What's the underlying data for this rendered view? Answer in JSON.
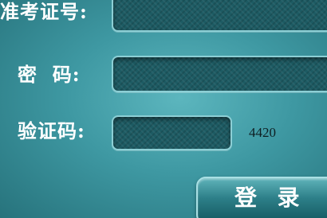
{
  "form": {
    "ticket_label": "准考证号:",
    "ticket_value": "",
    "password_label": "密  码:",
    "password_value": "",
    "captcha_label": "验证码:",
    "captcha_value": "",
    "captcha_code": "4420"
  },
  "actions": {
    "login_label": "登  录"
  }
}
